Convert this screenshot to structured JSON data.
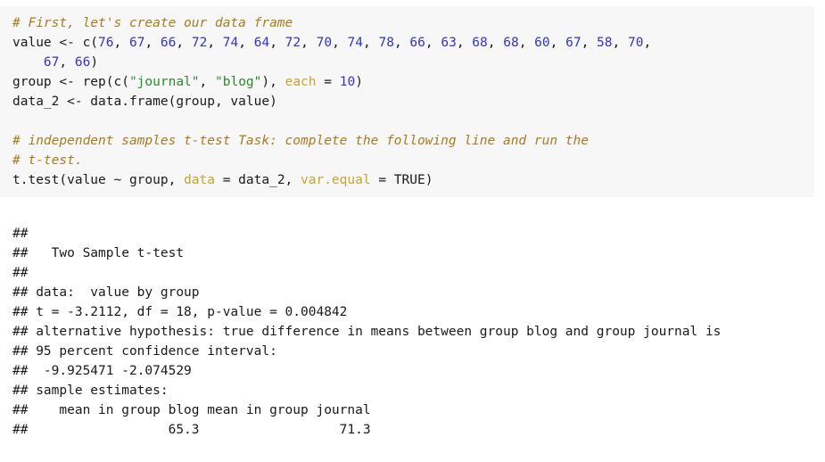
{
  "document": {
    "type": "r-markdown-knitted-output",
    "code_background": "#f7f7f7",
    "text_color": "#1a1a1a",
    "syntax_colors": {
      "comment": "#a67c1f",
      "number": "#3333cc",
      "string": "#2c8a2c",
      "argument": "#c8a433"
    }
  },
  "code_chunk": {
    "lines": [
      {
        "id": "comment-create-data-frame",
        "tokens": [
          {
            "text": "# First, let's create our data frame",
            "type": "comment"
          }
        ]
      },
      {
        "id": "value-assign",
        "tokens": [
          {
            "text": "value <- c(",
            "type": "plain"
          },
          {
            "text": "76",
            "type": "num"
          },
          {
            "text": ", ",
            "type": "plain"
          },
          {
            "text": "67",
            "type": "num"
          },
          {
            "text": ", ",
            "type": "plain"
          },
          {
            "text": "66",
            "type": "num"
          },
          {
            "text": ", ",
            "type": "plain"
          },
          {
            "text": "72",
            "type": "num"
          },
          {
            "text": ", ",
            "type": "plain"
          },
          {
            "text": "74",
            "type": "num"
          },
          {
            "text": ", ",
            "type": "plain"
          },
          {
            "text": "64",
            "type": "num"
          },
          {
            "text": ", ",
            "type": "plain"
          },
          {
            "text": "72",
            "type": "num"
          },
          {
            "text": ", ",
            "type": "plain"
          },
          {
            "text": "70",
            "type": "num"
          },
          {
            "text": ", ",
            "type": "plain"
          },
          {
            "text": "74",
            "type": "num"
          },
          {
            "text": ", ",
            "type": "plain"
          },
          {
            "text": "78",
            "type": "num"
          },
          {
            "text": ", ",
            "type": "plain"
          },
          {
            "text": "66",
            "type": "num"
          },
          {
            "text": ", ",
            "type": "plain"
          },
          {
            "text": "63",
            "type": "num"
          },
          {
            "text": ", ",
            "type": "plain"
          },
          {
            "text": "68",
            "type": "num"
          },
          {
            "text": ", ",
            "type": "plain"
          },
          {
            "text": "68",
            "type": "num"
          },
          {
            "text": ", ",
            "type": "plain"
          },
          {
            "text": "60",
            "type": "num"
          },
          {
            "text": ", ",
            "type": "plain"
          },
          {
            "text": "67",
            "type": "num"
          },
          {
            "text": ", ",
            "type": "plain"
          },
          {
            "text": "58",
            "type": "num"
          },
          {
            "text": ", ",
            "type": "plain"
          },
          {
            "text": "70",
            "type": "num"
          },
          {
            "text": ",",
            "type": "plain"
          }
        ]
      },
      {
        "id": "value-assign-continued",
        "tokens": [
          {
            "text": "    ",
            "type": "plain"
          },
          {
            "text": "67",
            "type": "num"
          },
          {
            "text": ", ",
            "type": "plain"
          },
          {
            "text": "66",
            "type": "num"
          },
          {
            "text": ")",
            "type": "plain"
          }
        ]
      },
      {
        "id": "group-assign",
        "tokens": [
          {
            "text": "group <- rep(c(",
            "type": "plain"
          },
          {
            "text": "\"journal\"",
            "type": "str"
          },
          {
            "text": ", ",
            "type": "plain"
          },
          {
            "text": "\"blog\"",
            "type": "str"
          },
          {
            "text": "), ",
            "type": "plain"
          },
          {
            "text": "each",
            "type": "arg"
          },
          {
            "text": " = ",
            "type": "plain"
          },
          {
            "text": "10",
            "type": "num"
          },
          {
            "text": ")",
            "type": "plain"
          }
        ]
      },
      {
        "id": "data-frame-assign",
        "tokens": [
          {
            "text": "data_2 <- data.frame(group, value)",
            "type": "plain"
          }
        ]
      },
      {
        "id": "blank-1",
        "tokens": [
          {
            "text": " ",
            "type": "plain"
          }
        ]
      },
      {
        "id": "comment-task-line-1",
        "tokens": [
          {
            "text": "# independent samples t-test Task: complete the following line and run the",
            "type": "comment"
          }
        ]
      },
      {
        "id": "comment-task-line-2",
        "tokens": [
          {
            "text": "# t-test.",
            "type": "comment"
          }
        ]
      },
      {
        "id": "t-test-call",
        "tokens": [
          {
            "text": "t.test(value ~ group, ",
            "type": "plain"
          },
          {
            "text": "data",
            "type": "arg"
          },
          {
            "text": " = data_2, ",
            "type": "plain"
          },
          {
            "text": "var.equal",
            "type": "arg"
          },
          {
            "text": " = TRUE)",
            "type": "plain"
          }
        ]
      }
    ]
  },
  "console_output": {
    "lines": [
      "## ",
      "##   Two Sample t-test",
      "## ",
      "## data:  value by group",
      "## t = -3.2112, df = 18, p-value = 0.004842",
      "## alternative hypothesis: true difference in means between group blog and group journal is",
      "## 95 percent confidence interval:",
      "##  -9.925471 -2.074529",
      "## sample estimates:",
      "##    mean in group blog mean in group journal",
      "##                  65.3                  71.3"
    ]
  },
  "statistics": {
    "test_name": "Two Sample t-test",
    "data_description": "value by group",
    "t_statistic": "-3.2112",
    "df": "18",
    "p_value": "0.004842",
    "confidence_level": "95 percent confidence interval",
    "conf_int_lower": "-9.925471",
    "conf_int_upper": "-2.074529",
    "mean_group_blog": "65.3",
    "mean_group_journal": "71.3"
  }
}
